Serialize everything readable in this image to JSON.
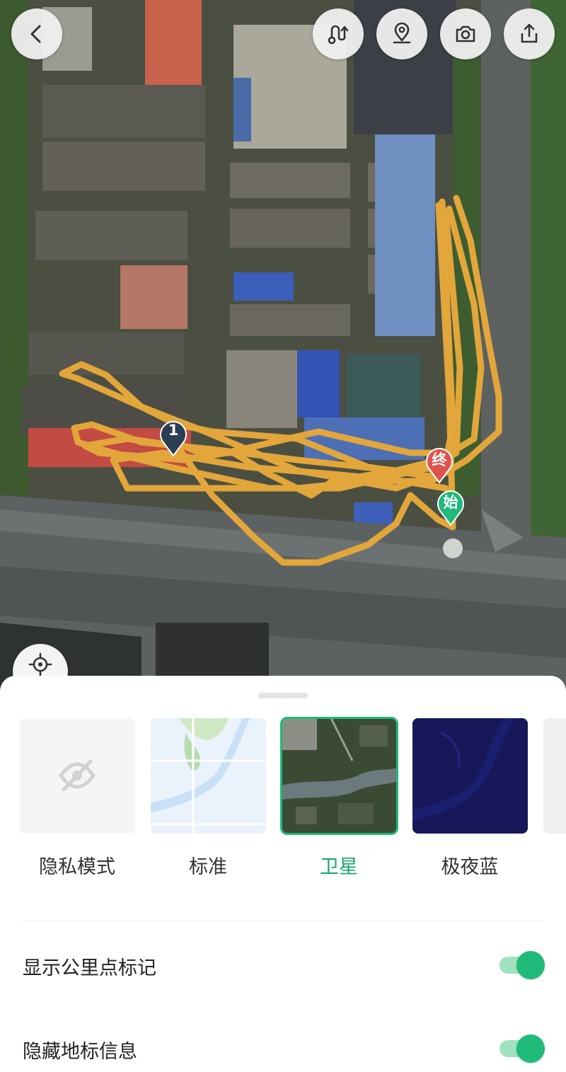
{
  "map": {
    "markers": {
      "km_marker": "1",
      "end_marker": "终",
      "start_marker": "始"
    },
    "route_color": "#e2a63a",
    "top_buttons": [
      "back-icon",
      "route-icon",
      "location-pin-icon",
      "camera-icon",
      "share-icon"
    ],
    "locate_button": "crosshair-icon"
  },
  "sheet": {
    "map_styles": [
      {
        "label": "隐私模式",
        "selected": false,
        "icon": "eye-off-icon"
      },
      {
        "label": "标准",
        "selected": false
      },
      {
        "label": "卫星",
        "selected": true
      },
      {
        "label": "极夜蓝",
        "selected": false
      }
    ],
    "settings": [
      {
        "label": "显示公里点标记",
        "enabled": true
      },
      {
        "label": "隐藏地标信息",
        "enabled": true
      }
    ],
    "colors": {
      "accent": "#1fb97a",
      "toggle_track": "#9fe2bf"
    }
  }
}
